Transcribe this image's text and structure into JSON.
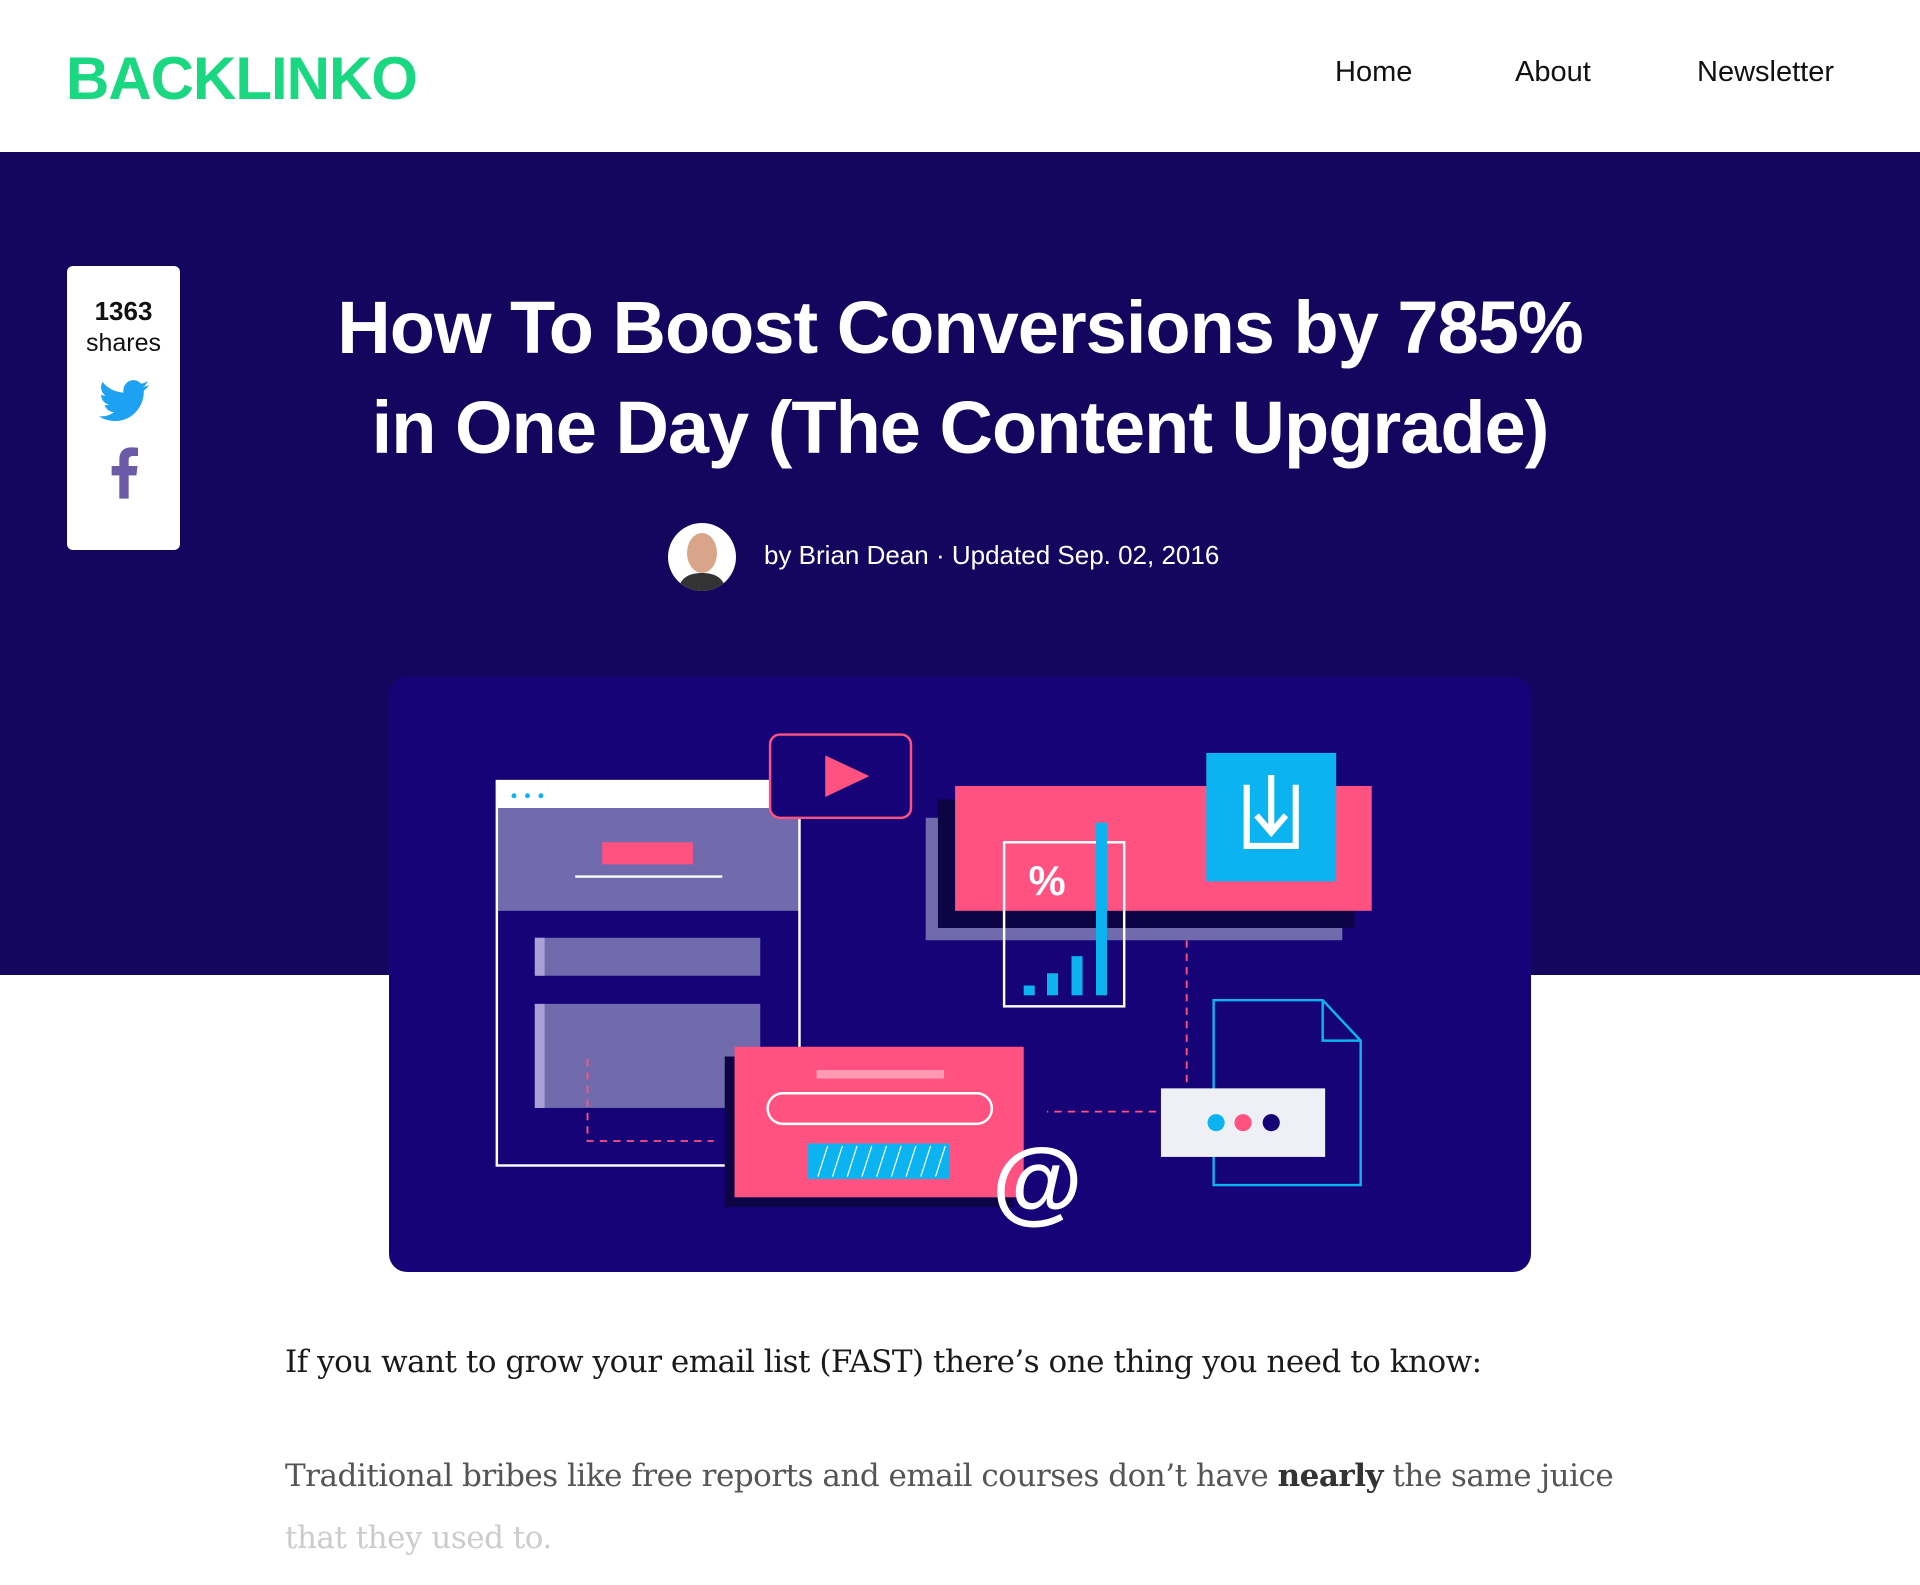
{
  "header": {
    "logo": "BACKLINKO",
    "nav": [
      "Home",
      "About",
      "Newsletter"
    ]
  },
  "share": {
    "count": "1363",
    "label": "shares",
    "icons": [
      "twitter-icon",
      "facebook-icon"
    ]
  },
  "article": {
    "title_line1": "How To Boost Conversions by 785%",
    "title_line2": "in One Day (The Content Upgrade)",
    "byline": "by Brian Dean · Updated Sep. 02, 2016",
    "para1": "If you want to grow your email list (FAST) there’s one thing you need to know:",
    "para2_a": "Traditional bribes like free reports and email courses don’t have ",
    "para2_bold": "nearly",
    "para2_b": " the same juice",
    "para2_c": "that they used to."
  },
  "illustration": {
    "percent_symbol": "%",
    "at_symbol": "@"
  },
  "colors": {
    "brand": "#1ad881",
    "hero_bg": "#14065f",
    "pink": "#ff5281",
    "blue": "#0bb4f0",
    "purple": "#716aad"
  }
}
